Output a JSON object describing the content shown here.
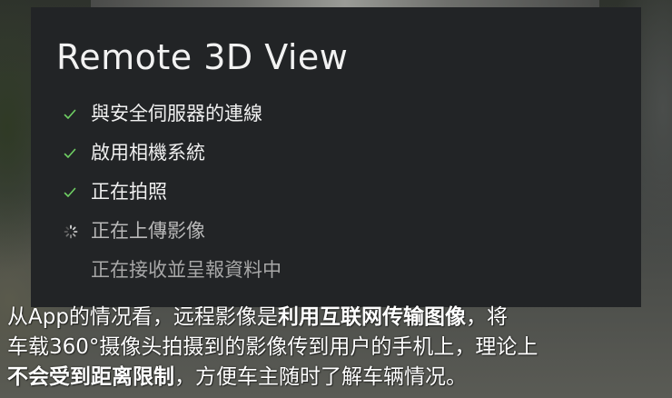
{
  "panel": {
    "title": "Remote 3D View",
    "steps": [
      {
        "label": "與安全伺服器的連線",
        "status": "done",
        "icon": "check-icon"
      },
      {
        "label": "啟用相機系統",
        "status": "done",
        "icon": "check-icon"
      },
      {
        "label": "正在拍照",
        "status": "done",
        "icon": "check-icon"
      },
      {
        "label": "正在上傳影像",
        "status": "in-progress",
        "icon": "spinner-icon"
      },
      {
        "label": "正在接收並呈報資料中",
        "status": "pending",
        "icon": ""
      }
    ]
  },
  "caption": {
    "line1": {
      "a": "从App的情况看，远程影像是",
      "b": "利用互联网传输图像",
      "c": "，将"
    },
    "line2": "车载360°摄像头拍摄到的影像传到用户的手机上，理论上",
    "line3": {
      "a": "不会受到距离限制",
      "b": "，方便车主随时了解车辆情况。"
    }
  },
  "colors": {
    "panel_bg": "#222426",
    "check": "#6fcf63",
    "text_done": "#f0f0f0",
    "text_pending": "#a8a8a8"
  }
}
